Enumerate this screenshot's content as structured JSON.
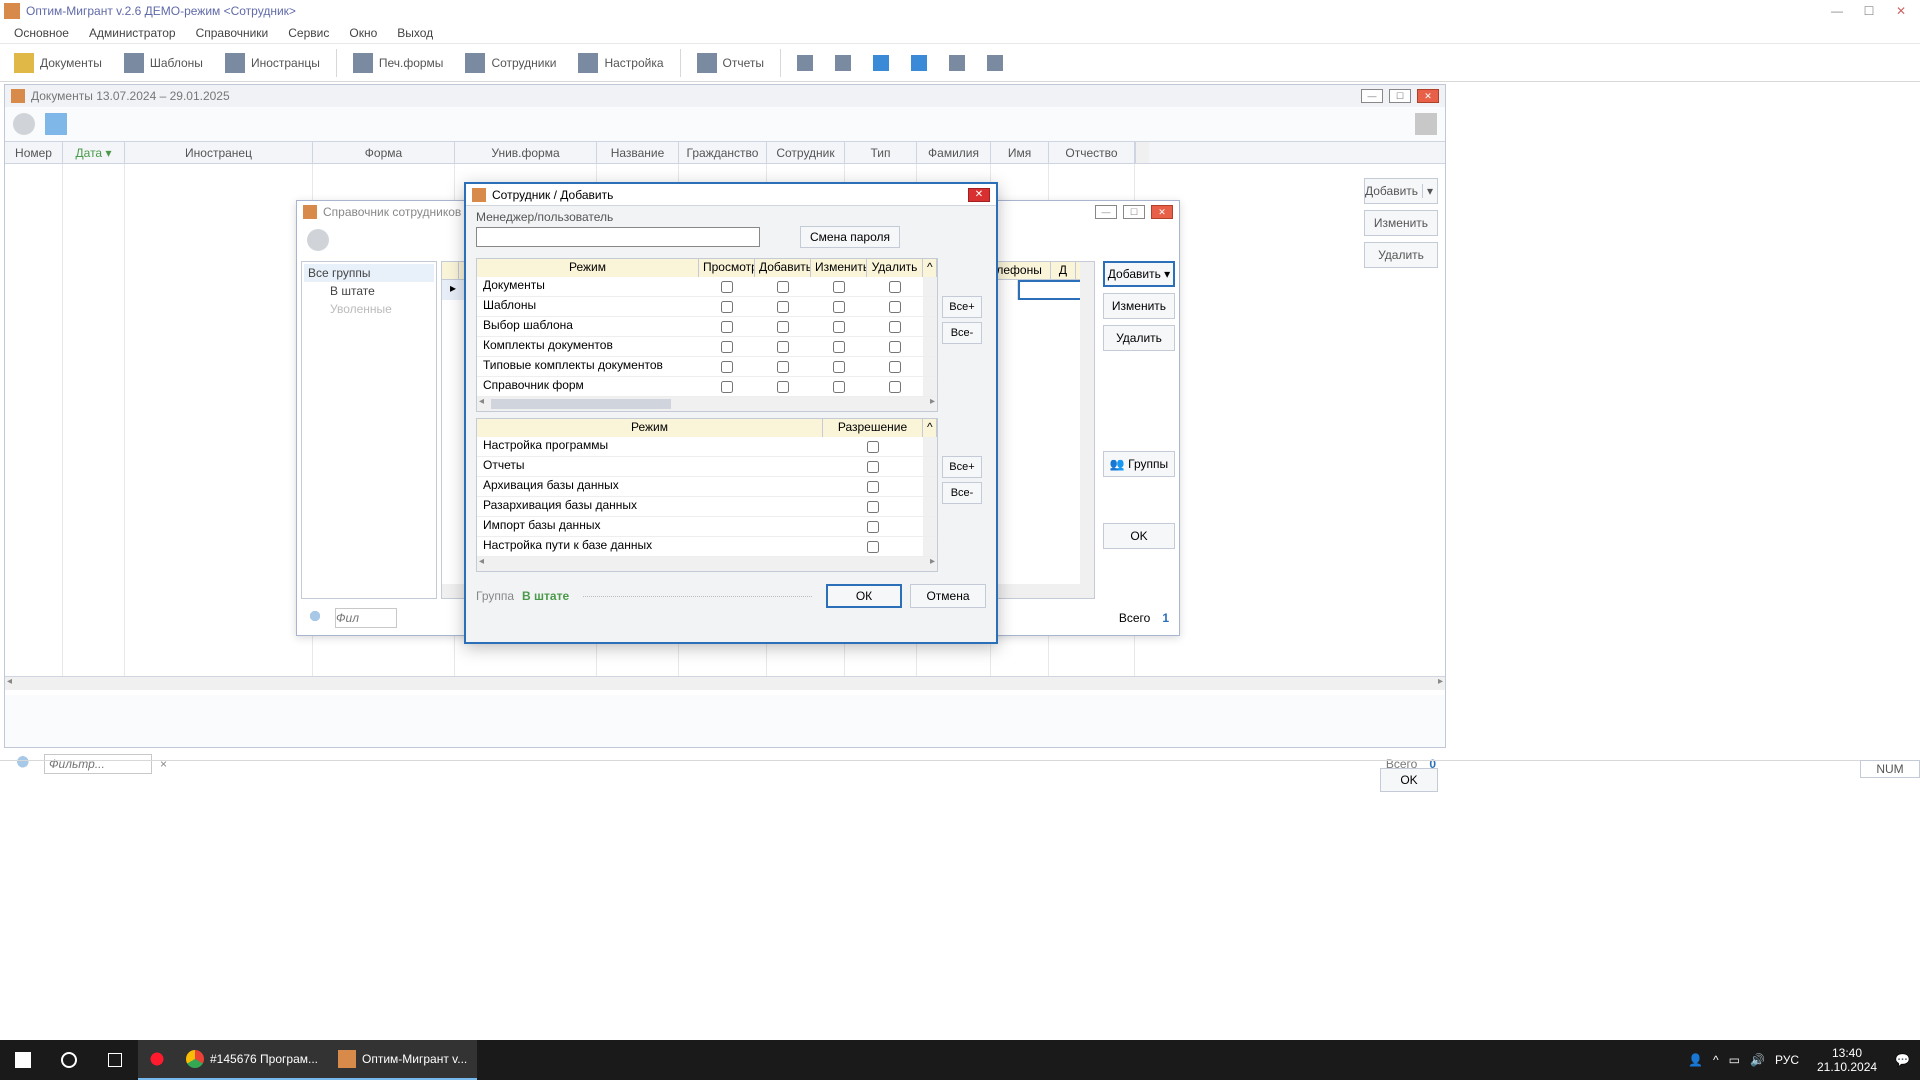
{
  "app": {
    "title": "Оптим-Мигрант v.2.6   ДЕМО-режим   <Сотрудник>"
  },
  "menu": [
    "Основное",
    "Администратор",
    "Справочники",
    "Сервис",
    "Окно",
    "Выход"
  ],
  "toolbar": [
    "Документы",
    "Шаблоны",
    "Иностранцы",
    "Печ.формы",
    "Сотрудники",
    "Настройка",
    "Отчеты"
  ],
  "docwin": {
    "title": "Документы  13.07.2024  –  29.01.2025",
    "columns": [
      "Номер",
      "Дата ▾",
      "Иностранец",
      "Форма",
      "Унив.форма",
      "Название",
      "Гражданство",
      "Сотрудник",
      "Тип",
      "Фамилия",
      "Имя",
      "Отчество"
    ],
    "buttons": {
      "add": "Добавить",
      "edit": "Изменить",
      "del": "Удалить",
      "ok": "OK"
    },
    "filter_placeholder": "Фильтр...",
    "total_label": "Всего",
    "total_value": "0"
  },
  "dirwin": {
    "title": "Справочник сотрудников",
    "tree": {
      "root": "Все группы",
      "staff": "В штате",
      "fired": "Уволенные"
    },
    "columns_right": [
      "елефоны",
      "Д"
    ],
    "buttons": {
      "add": "Добавить",
      "edit": "Изменить",
      "del": "Удалить",
      "groups": "Группы",
      "ok": "OK"
    },
    "filter_placeholder": "Фил",
    "total_label": "Всего",
    "total_value": "1"
  },
  "empdlg": {
    "title": "Сотрудник / Добавить",
    "mgr_label": "Менеджер/пользователь",
    "pwd_btn": "Смена пароля",
    "perm_head": {
      "mode": "Режим",
      "view": "Просмотр",
      "add": "Добавить",
      "edit": "Изменить",
      "del": "Удалить"
    },
    "perm_rows": [
      "Документы",
      "Шаблоны",
      "Выбор шаблона",
      "Комплекты документов",
      "Типовые комплекты документов",
      "Справочник форм"
    ],
    "perm2_head": {
      "mode": "Режим",
      "allow": "Разрешение"
    },
    "perm2_rows": [
      "Настройка программы",
      "Отчеты",
      "Архивация базы данных",
      "Разархивация базы данных",
      "Импорт базы данных",
      "Настройка пути к базе данных"
    ],
    "all_plus": "Все+",
    "all_minus": "Все-",
    "group_label": "Группа",
    "group_value": "В штате",
    "ok": "ОК",
    "cancel": "Отмена"
  },
  "statusbar": {
    "num": "NUM"
  },
  "taskbar": {
    "task1": "#145676 Програм...",
    "task2": "Оптим-Мигрант v...",
    "lang": "РУС",
    "time": "13:40",
    "date": "21.10.2024"
  }
}
